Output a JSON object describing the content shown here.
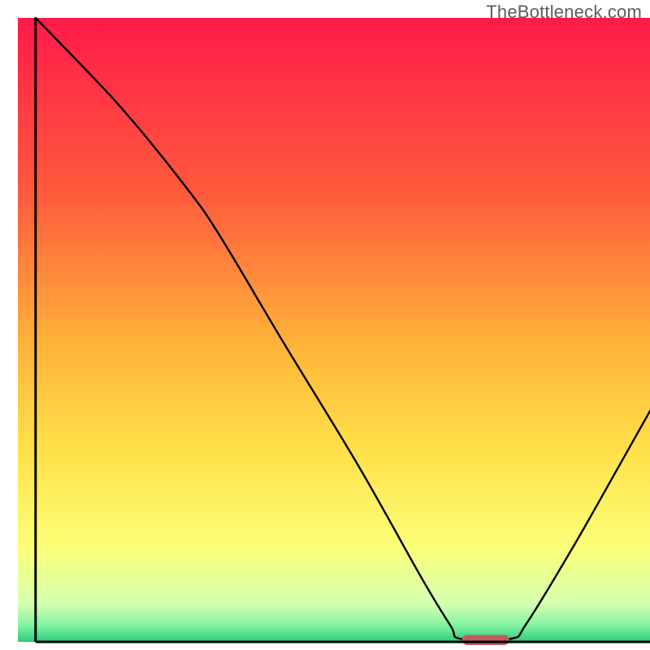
{
  "watermark": "TheBottleneck.com",
  "chart_data": {
    "type": "line",
    "title": "",
    "xlabel": "",
    "ylabel": "",
    "x_range": [
      0,
      100
    ],
    "y_range": [
      0,
      100
    ],
    "gradient_stops": [
      {
        "offset": 0,
        "color": "#ff1a4a"
      },
      {
        "offset": 0.28,
        "color": "#ff5a3c"
      },
      {
        "offset": 0.52,
        "color": "#ffb23a"
      },
      {
        "offset": 0.7,
        "color": "#ffe24a"
      },
      {
        "offset": 0.85,
        "color": "#fbff7a"
      },
      {
        "offset": 0.94,
        "color": "#d4ffb0"
      },
      {
        "offset": 0.975,
        "color": "#7ef2a0"
      },
      {
        "offset": 1.0,
        "color": "#2aca7a"
      }
    ],
    "curve": [
      {
        "x": 2.8,
        "y": 100.0
      },
      {
        "x": 16.0,
        "y": 86.0
      },
      {
        "x": 26.5,
        "y": 73.0
      },
      {
        "x": 32.0,
        "y": 65.0
      },
      {
        "x": 42.0,
        "y": 48.0
      },
      {
        "x": 54.0,
        "y": 28.0
      },
      {
        "x": 64.0,
        "y": 10.0
      },
      {
        "x": 68.5,
        "y": 2.5
      },
      {
        "x": 70.0,
        "y": 0.5
      },
      {
        "x": 78.0,
        "y": 0.5
      },
      {
        "x": 80.5,
        "y": 3.0
      },
      {
        "x": 88.0,
        "y": 15.5
      },
      {
        "x": 95.0,
        "y": 28.0
      },
      {
        "x": 100.0,
        "y": 37.0
      }
    ],
    "optimal_marker": {
      "x_center": 74.0,
      "width": 7.5,
      "y": 0.3,
      "height": 1.6,
      "color": "#c05a5f"
    },
    "axes": {
      "left": {
        "x": 2.8,
        "y0": 0,
        "y1": 100
      },
      "bottom": {
        "y": 0.0,
        "x0": 2.8,
        "x1": 100
      }
    }
  }
}
